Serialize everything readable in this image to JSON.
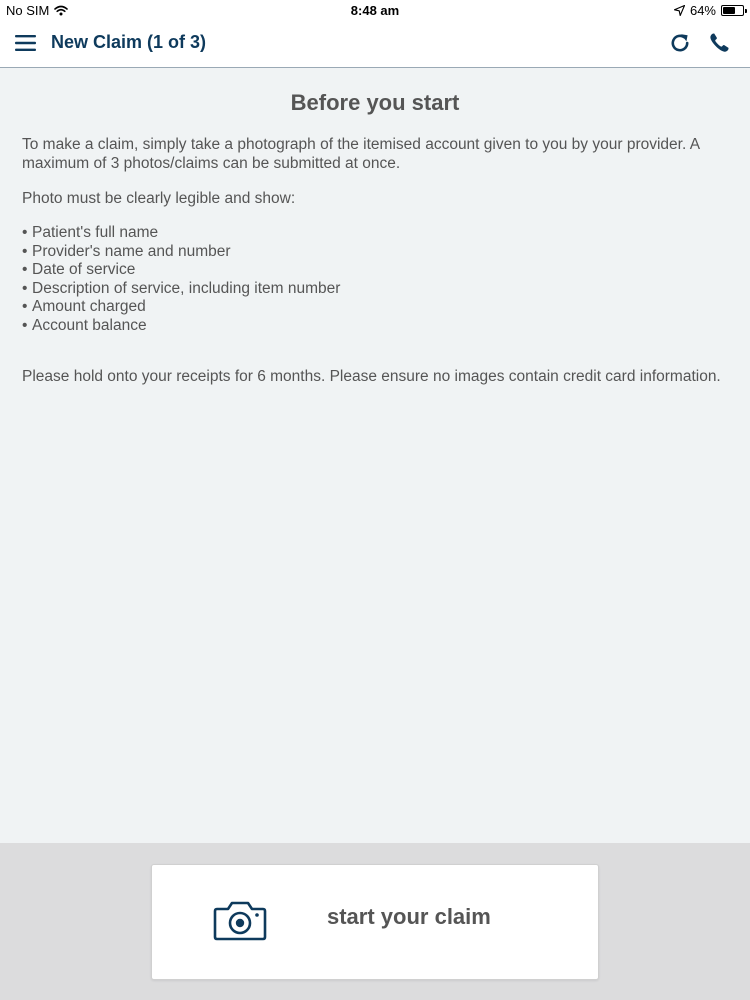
{
  "status_bar": {
    "carrier": "No SIM",
    "time": "8:48 am",
    "battery": "64%",
    "battery_level": 0.64
  },
  "nav": {
    "title": "New Claim (1 of 3)"
  },
  "content": {
    "heading": "Before you start",
    "intro": "To make a claim, simply take a photograph of the itemised account given to you by your provider.  A maximum of 3 photos/claims can be submitted at once.",
    "must_show": "Photo must be clearly legible and show:",
    "bullets": [
      "Patient's full name",
      "Provider's name and number",
      "Date of service",
      "Description of service, including item number",
      "Amount charged",
      "Account balance"
    ],
    "receipts_note": "Please hold onto your receipts for 6 months.  Please ensure no images contain credit card information."
  },
  "footer": {
    "start_label": "start your claim"
  },
  "colors": {
    "brand_navy": "#0e3a5c",
    "text_gray": "#555555",
    "content_bg": "#f0f3f4",
    "footer_bg": "#dcdcdd"
  },
  "icons": {
    "menu": "hamburger-menu-icon",
    "refresh": "refresh-icon",
    "phone": "phone-icon",
    "camera": "camera-icon",
    "wifi": "wifi-icon",
    "location": "location-arrow-icon",
    "battery": "battery-icon"
  }
}
